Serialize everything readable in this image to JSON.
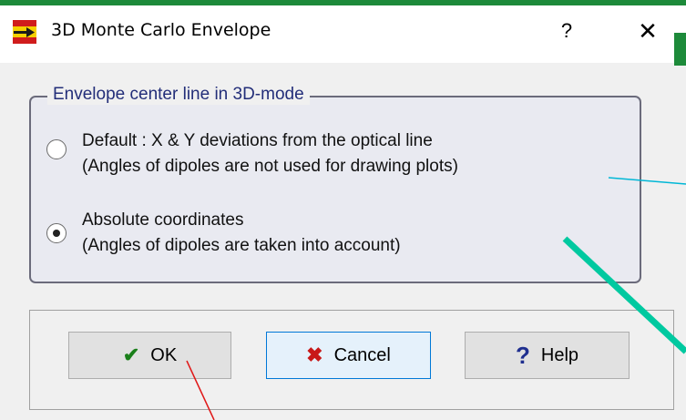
{
  "dialog": {
    "title": "3D Monte Carlo Envelope",
    "help_glyph": "?",
    "close_glyph": "✕"
  },
  "group": {
    "label": "Envelope center line in 3D-mode",
    "options": [
      {
        "line1": "Default : X & Y deviations from the optical line",
        "line2": "(Angles of dipoles are not used for drawing plots)",
        "selected": false
      },
      {
        "line1": "Absolute coordinates",
        "line2": "(Angles of dipoles are taken into account)",
        "selected": true
      }
    ]
  },
  "buttons": {
    "ok": {
      "label": "OK",
      "icon": "checkmark-icon"
    },
    "cancel": {
      "label": "Cancel",
      "icon": "x-cancel-icon"
    },
    "help": {
      "label": "Help",
      "icon": "question-icon"
    }
  },
  "colors": {
    "group_label": "#232e79",
    "ok_check": "#1a7f1a",
    "cancel_x": "#c81818",
    "help_q": "#1f2f8f",
    "annotation_cyan": "#00b7d6",
    "annotation_teal": "#00c9a0",
    "annotation_red": "#e01818"
  }
}
